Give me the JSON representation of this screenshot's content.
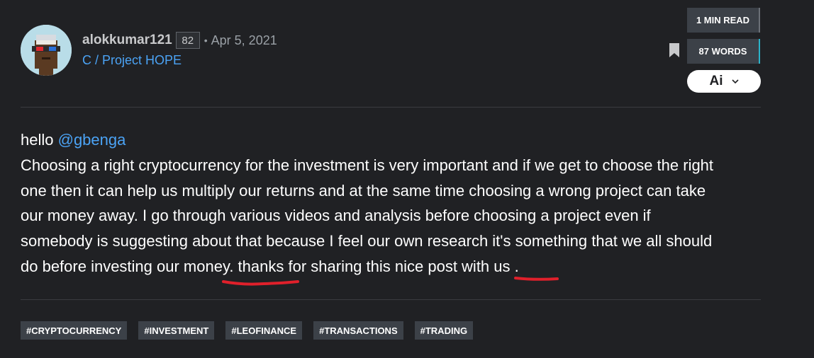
{
  "author": {
    "username": "alokkumar121",
    "reputation": "82",
    "separator": "•",
    "date": "Apr 5, 2021",
    "community": "C / Project HOPE",
    "avatar_icon": "pixel-punk-avatar"
  },
  "meta": {
    "read_time": "1 MIN READ",
    "word_count": "87 WORDS",
    "ai_label": "Ai",
    "bookmark_icon": "bookmark-icon",
    "chevron_icon": "chevron-down-icon"
  },
  "post": {
    "greeting": "hello",
    "mention": "@gbenga",
    "lines": [
      "Choosing a right cryptocurrency for the investment is very important and if we get to choose the right",
      "one then it can help us multiply our returns and at the same time choosing a wrong project can take",
      "our money away. I go through various videos and analysis before choosing a project even if",
      "somebody is suggesting about that because I feel our own research it's something that we all should",
      "do before investing our money. thanks for sharing this nice post with us ."
    ]
  },
  "tags": [
    "#CRYPTOCURRENCY",
    "#INVESTMENT",
    "#LEOFINANCE",
    "#TRANSACTIONS",
    "#TRADING"
  ],
  "colors": {
    "background": "#202124",
    "accent": "#4ba3f5",
    "annotation": "#e0202b",
    "tag_bg": "#3c4148"
  }
}
